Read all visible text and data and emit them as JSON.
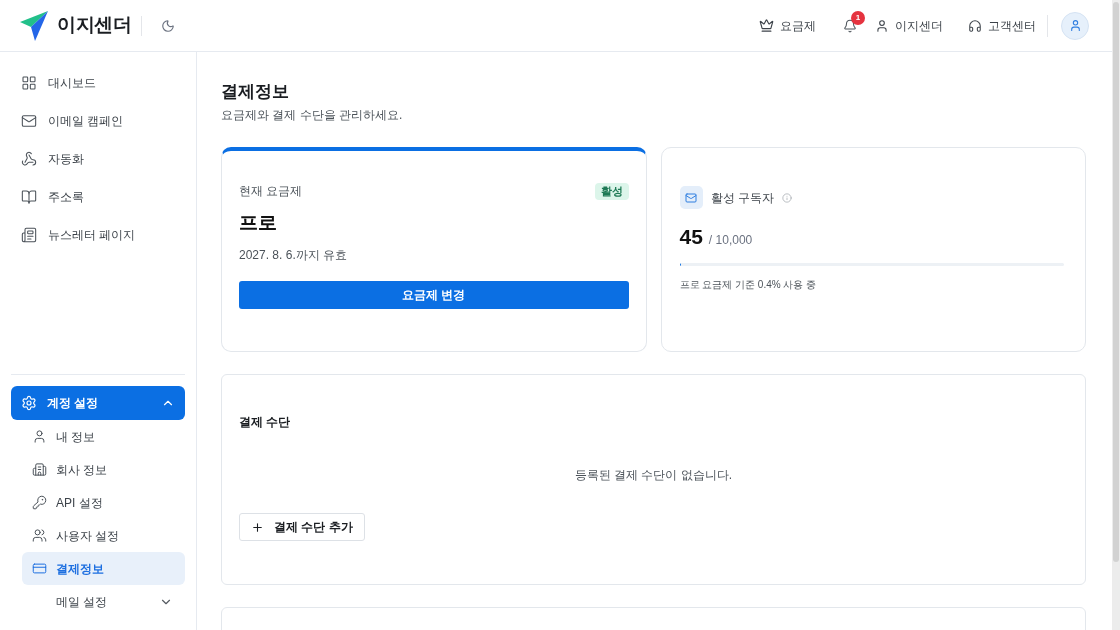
{
  "header": {
    "brand": "이지센더",
    "nav": [
      {
        "label": "요금제"
      },
      {
        "label": "이지센더"
      },
      {
        "label": "고객센터"
      }
    ],
    "notifications": {
      "count": "1"
    }
  },
  "sidebar": {
    "items": [
      {
        "label": "대시보드",
        "selected": false
      },
      {
        "label": "이메일 캠페인",
        "selected": false
      },
      {
        "label": "자동화",
        "selected": false
      },
      {
        "label": "주소록",
        "selected": false
      },
      {
        "label": "뉴스레터 페이지",
        "selected": false
      }
    ],
    "settings_group": {
      "label": "계정 설정",
      "active": true,
      "expanded": true,
      "children": [
        {
          "label": "내 정보",
          "selected": false
        },
        {
          "label": "회사 정보",
          "selected": false
        },
        {
          "label": "API 설정",
          "selected": false
        },
        {
          "label": "사용자 설정",
          "selected": false
        },
        {
          "label": "결제정보",
          "selected": true
        },
        {
          "label": "메일 설정",
          "selected": false,
          "expanded": false
        }
      ]
    }
  },
  "page": {
    "title": "결제정보",
    "subtitle": "요금제와 결제 수단을 관리하세요."
  },
  "plan_card": {
    "label": "현재 요금제",
    "status": "활성",
    "name": "프로",
    "valid_until": "2027. 8. 6.까지 유효",
    "button": "요금제 변경"
  },
  "subscribers_card": {
    "label": "활성 구독자",
    "count": "45",
    "limit": "/ 10,000",
    "level": 0.004,
    "note": "프로 요금제 기준 0.4% 사용 중"
  },
  "payment_methods": {
    "title": "결제 수단",
    "empty_message": "등록된 결제 수단이 없습니다.",
    "add_button": "결제 수단 추가"
  }
}
